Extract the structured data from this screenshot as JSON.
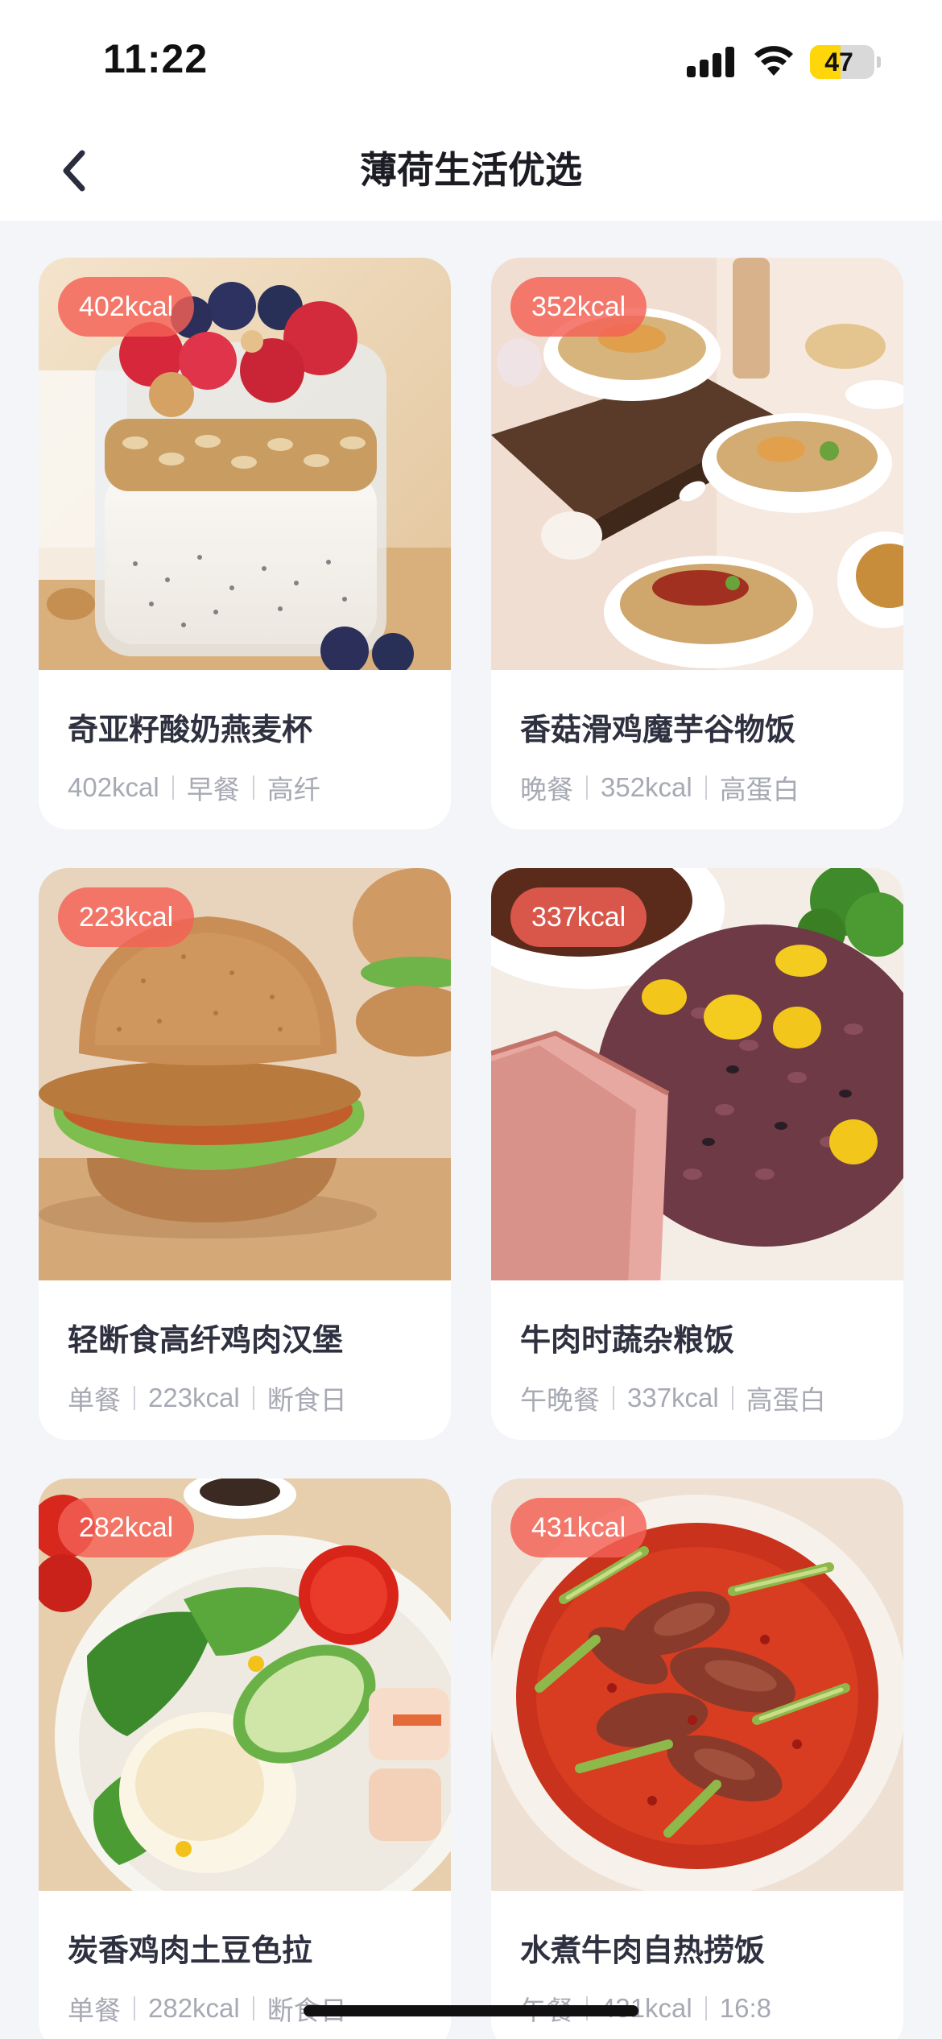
{
  "status_bar": {
    "time": "11:22",
    "battery_level": "47",
    "battery_fraction": 0.47,
    "icons": [
      "signal-icon",
      "wifi-icon",
      "battery-icon"
    ]
  },
  "nav": {
    "title": "薄荷生活优选",
    "back_icon": "chevron-left-icon"
  },
  "colors": {
    "badge": "#f46056",
    "background": "#f3f5f9",
    "card": "#ffffff",
    "title": "#2f3140",
    "tags": "#a7a9b3"
  },
  "products": [
    {
      "badge": "402kcal",
      "name": "奇亚籽酸奶燕麦杯",
      "tags": [
        "402kcal",
        "早餐",
        "高纤"
      ],
      "image": "yogurt-oat-jar-photo"
    },
    {
      "badge": "352kcal",
      "name": "香菇滑鸡魔芋谷物饭",
      "tags": [
        "晚餐",
        "352kcal",
        "高蛋白"
      ],
      "image": "chicken-grain-bowls-photo"
    },
    {
      "badge": "223kcal",
      "name": "轻断食高纤鸡肉汉堡",
      "tags": [
        "单餐",
        "223kcal",
        "断食日"
      ],
      "image": "chicken-burger-photo"
    },
    {
      "badge": "337kcal",
      "name": "牛肉时蔬杂粮饭",
      "tags": [
        "午晚餐",
        "337kcal",
        "高蛋白"
      ],
      "image": "beef-multigrain-rice-photo"
    },
    {
      "badge": "282kcal",
      "name": "炭香鸡肉土豆色拉",
      "tags": [
        "单餐",
        "282kcal",
        "断食日"
      ],
      "image": "chicken-potato-salad-photo"
    },
    {
      "badge": "431kcal",
      "name": "水煮牛肉自热捞饭",
      "tags": [
        "午餐",
        "431kcal",
        "16:8"
      ],
      "image": "boiled-beef-rice-photo"
    }
  ]
}
